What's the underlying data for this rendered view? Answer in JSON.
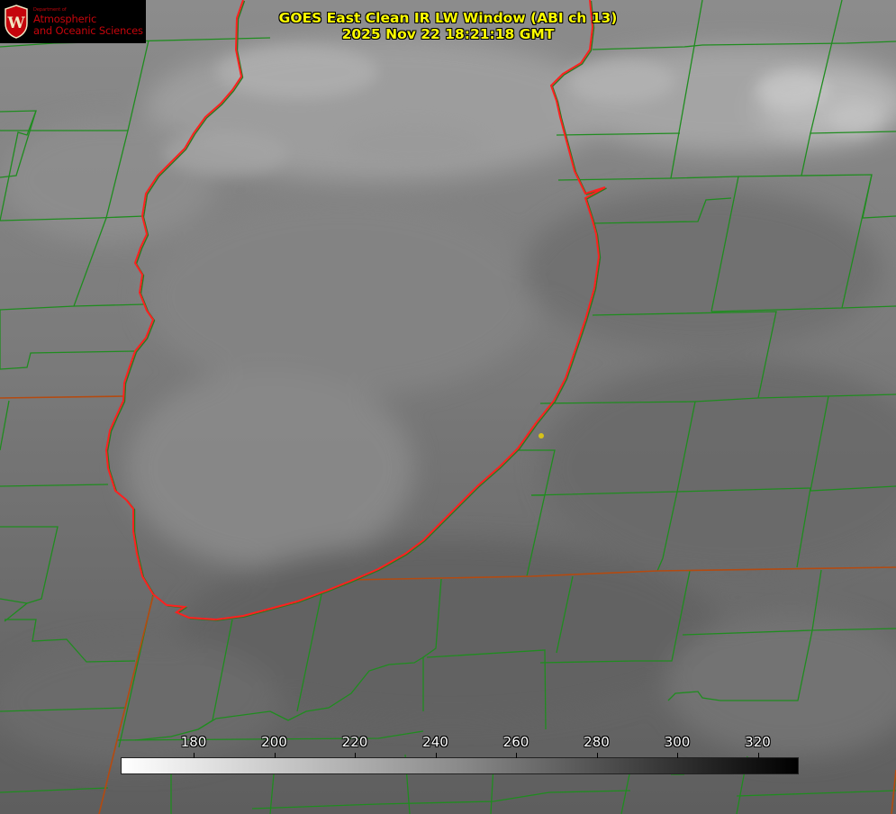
{
  "title": {
    "line1": "GOES East Clean IR LW Window (ABI ch 13)",
    "line2": "2025 Nov 22 18:21:18 GMT"
  },
  "logo": {
    "department": "Department of",
    "line1": "Atmospheric",
    "line2": "and Oceanic Sciences",
    "seal_letter": "W",
    "color": "#c5050c"
  },
  "colorbar": {
    "ticks": [
      "180",
      "200",
      "220",
      "240",
      "260",
      "280",
      "300",
      "320"
    ],
    "min_color": "#ffffff",
    "max_color": "#000000"
  },
  "colors": {
    "county_lines": "#1f8c1f",
    "lake_outline": "#ff2020",
    "state_lines": "#b44a10",
    "marker": "#d6c21a",
    "title_text": "#ffff00"
  }
}
